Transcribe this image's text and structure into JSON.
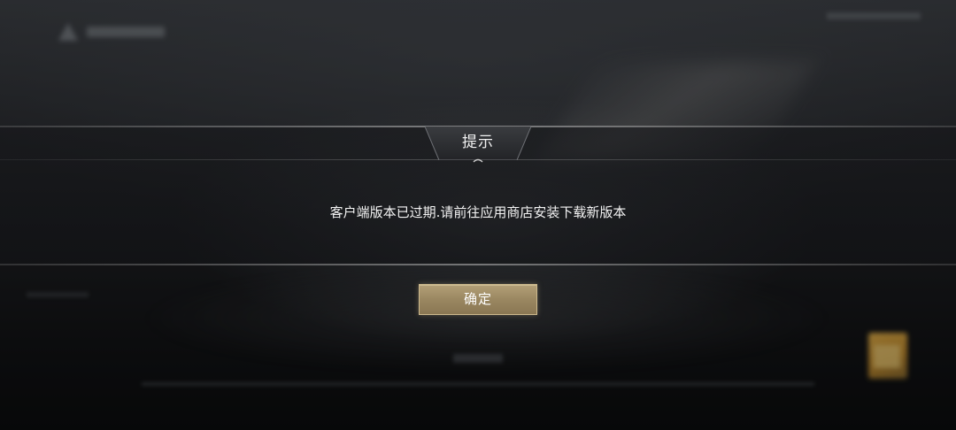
{
  "dialog": {
    "title": "提示",
    "message": "客户端版本已过期.请前往应用商店安装下载新版本",
    "confirm_label": "确定"
  },
  "colors": {
    "accent_button": "#9a8761",
    "button_border": "#cdb98d",
    "text": "#f2f2f2",
    "background": "#1c1d20"
  },
  "icons": {
    "game_logo": "game-logo-icon",
    "corner_badge": "event-badge-icon"
  }
}
